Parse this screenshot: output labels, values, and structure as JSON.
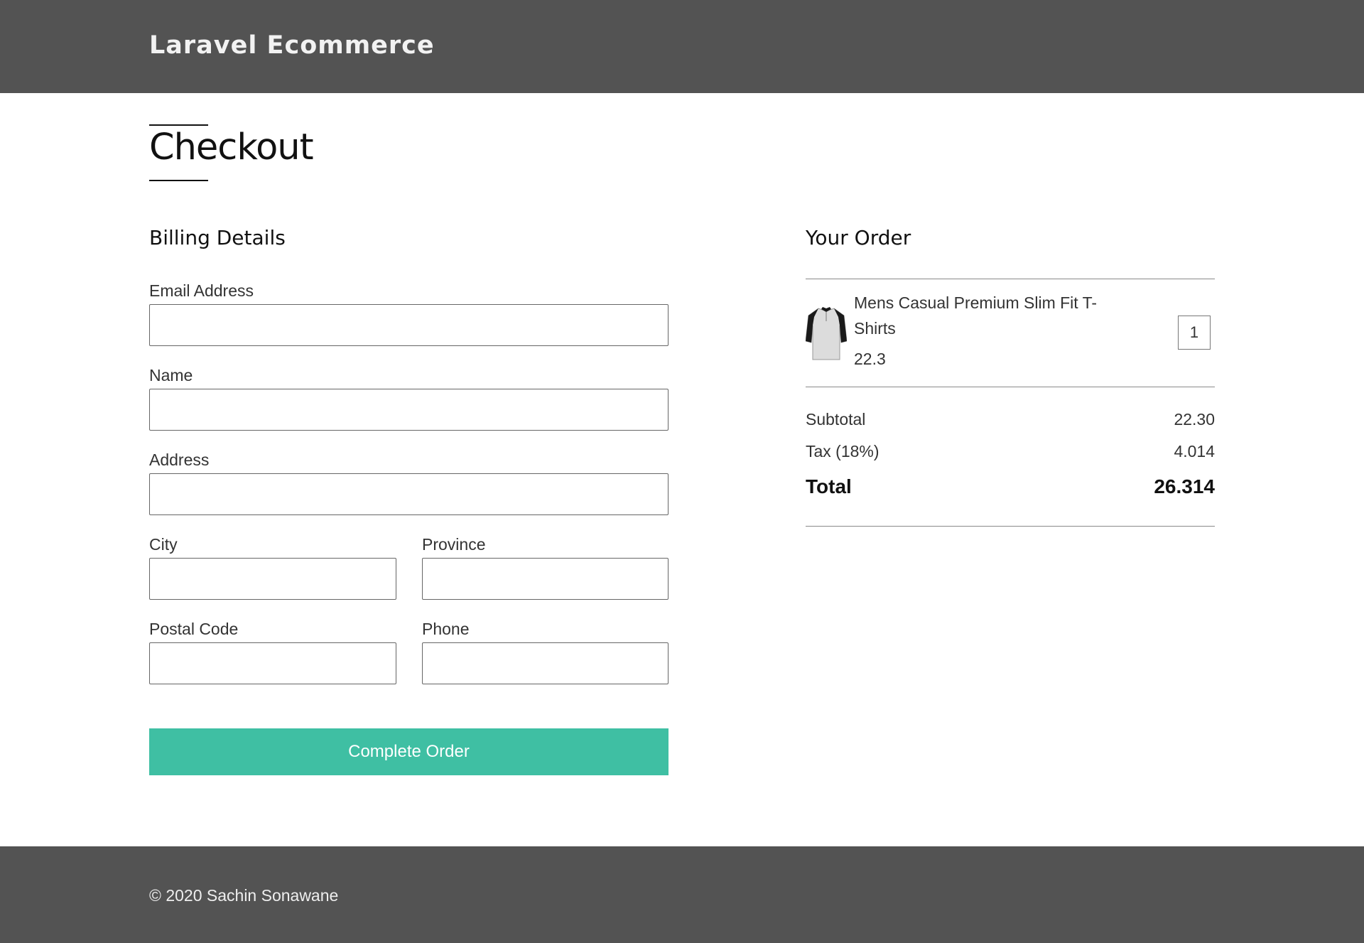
{
  "header": {
    "brand": "Laravel Ecommerce"
  },
  "page_title": "Checkout",
  "billing": {
    "title": "Billing Details",
    "email_label": "Email Address",
    "email_value": "",
    "name_label": "Name",
    "name_value": "",
    "address_label": "Address",
    "address_value": "",
    "city_label": "City",
    "city_value": "",
    "province_label": "Province",
    "province_value": "",
    "postal_label": "Postal Code",
    "postal_value": "",
    "phone_label": "Phone",
    "phone_value": "",
    "submit_label": "Complete Order"
  },
  "order": {
    "title": "Your Order",
    "items": [
      {
        "name": "Mens Casual Premium Slim Fit T-Shirts",
        "price": "22.3",
        "quantity": "1",
        "icon": "tshirt-icon"
      }
    ],
    "subtotal_label": "Subtotal",
    "subtotal_value": "22.30",
    "tax_label": "Tax (18%)",
    "tax_value": "4.014",
    "total_label": "Total",
    "total_value": "26.314"
  },
  "footer": {
    "copyright": "© 2020 Sachin Sonawane"
  },
  "colors": {
    "header_bg": "#535353",
    "button_bg": "#3fbfa3"
  }
}
